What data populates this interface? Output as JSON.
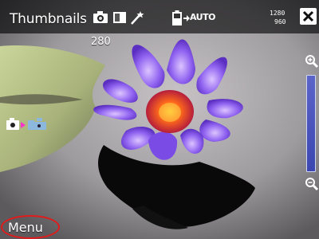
{
  "header": {
    "title": "Thumbnails",
    "icons": [
      "camera-icon",
      "contrast-icon",
      "magic-wand-icon",
      "battery-icon"
    ],
    "auto_label": "AUTO"
  },
  "gallery": {
    "count": "280",
    "resolution_top": "1280",
    "resolution_bottom": "960"
  },
  "controls": {
    "zoom_in": "zoom-in-icon",
    "zoom_out": "zoom-out-icon",
    "mode": [
      "camera-icon",
      "video-icon"
    ]
  },
  "footer": {
    "menu_label": "Menu"
  },
  "colors": {
    "accent": "#e01b1b",
    "zoom_track": "#4a53bf"
  }
}
